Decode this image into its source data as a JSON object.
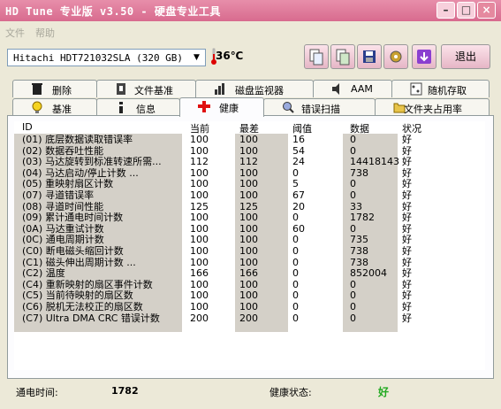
{
  "window": {
    "title": "HD Tune 专业版 v3.50 - 硬盘专业工具",
    "btn_min": "–",
    "btn_max": "□",
    "btn_close": "×"
  },
  "menu": [
    "文件",
    "帮助"
  ],
  "toolbar": {
    "drive": "Hitachi HDT721032SLA (320 GB)",
    "temperature": "36℃",
    "exit_label": "退出",
    "icons": [
      "copy-text-icon",
      "copy-screen-icon",
      "save-icon",
      "options-icon",
      "down-arrow-icon"
    ]
  },
  "tabs_top": [
    {
      "label": "删除",
      "icon": "trash-icon"
    },
    {
      "label": "文件基准",
      "icon": "file-benchmark-icon"
    },
    {
      "label": "磁盘监视器",
      "icon": "disk-monitor-icon"
    },
    {
      "label": "AAM",
      "icon": "speaker-icon"
    },
    {
      "label": "随机存取",
      "icon": "random-access-icon"
    }
  ],
  "tabs_bottom": [
    {
      "label": "基准",
      "icon": "bulb-icon"
    },
    {
      "label": "信息",
      "icon": "info-icon"
    },
    {
      "label": "健康",
      "icon": "health-cross-icon"
    },
    {
      "label": "错误扫描",
      "icon": "magnifier-icon"
    },
    {
      "label": "文件夹占用率",
      "icon": "folder-icon"
    }
  ],
  "table": {
    "headers": [
      "ID",
      "当前",
      "最差",
      "阈值",
      "数据",
      "状况"
    ],
    "rows": [
      [
        "(01) 底层数据读取错误率",
        "100",
        "100",
        "16",
        "0",
        "好"
      ],
      [
        "(02) 数据吞吐性能",
        "100",
        "100",
        "54",
        "0",
        "好"
      ],
      [
        "(03) 马达旋转到标准转速所需...",
        "112",
        "112",
        "24",
        "14418143",
        "好"
      ],
      [
        "(04) 马达启动/停止计数    ...",
        "100",
        "100",
        "0",
        "738",
        "好"
      ],
      [
        "(05) 重映射扇区计数",
        "100",
        "100",
        "5",
        "0",
        "好"
      ],
      [
        "(07) 寻道错误率",
        "100",
        "100",
        "67",
        "0",
        "好"
      ],
      [
        "(08) 寻道时间性能",
        "125",
        "125",
        "20",
        "33",
        "好"
      ],
      [
        "(09) 累计通电时间计数",
        "100",
        "100",
        "0",
        "1782",
        "好"
      ],
      [
        "(0A) 马达重试计数",
        "100",
        "100",
        "60",
        "0",
        "好"
      ],
      [
        "(0C) 通电周期计数",
        "100",
        "100",
        "0",
        "735",
        "好"
      ],
      [
        "(C0) 断电磁头缩回计数",
        "100",
        "100",
        "0",
        "738",
        "好"
      ],
      [
        "(C1) 磁头伸出周期计数     ...",
        "100",
        "100",
        "0",
        "738",
        "好"
      ],
      [
        "(C2) 温度",
        "166",
        "166",
        "0",
        "852004",
        "好"
      ],
      [
        "(C4) 重新映射的扇区事件计数",
        "100",
        "100",
        "0",
        "0",
        "好"
      ],
      [
        "(C5) 当前待映射的扇区数",
        "100",
        "100",
        "0",
        "0",
        "好"
      ],
      [
        "(C6) 脱机无法校正的扇区数",
        "100",
        "100",
        "0",
        "0",
        "好"
      ],
      [
        "(C7) Ultra DMA CRC 错误计数",
        "200",
        "200",
        "0",
        "0",
        "好"
      ]
    ]
  },
  "status": {
    "power_on_label": "通电时间:",
    "power_on_value": "1782",
    "health_label": "健康状态:",
    "health_value": "好",
    "health_color": "#22aa22"
  }
}
